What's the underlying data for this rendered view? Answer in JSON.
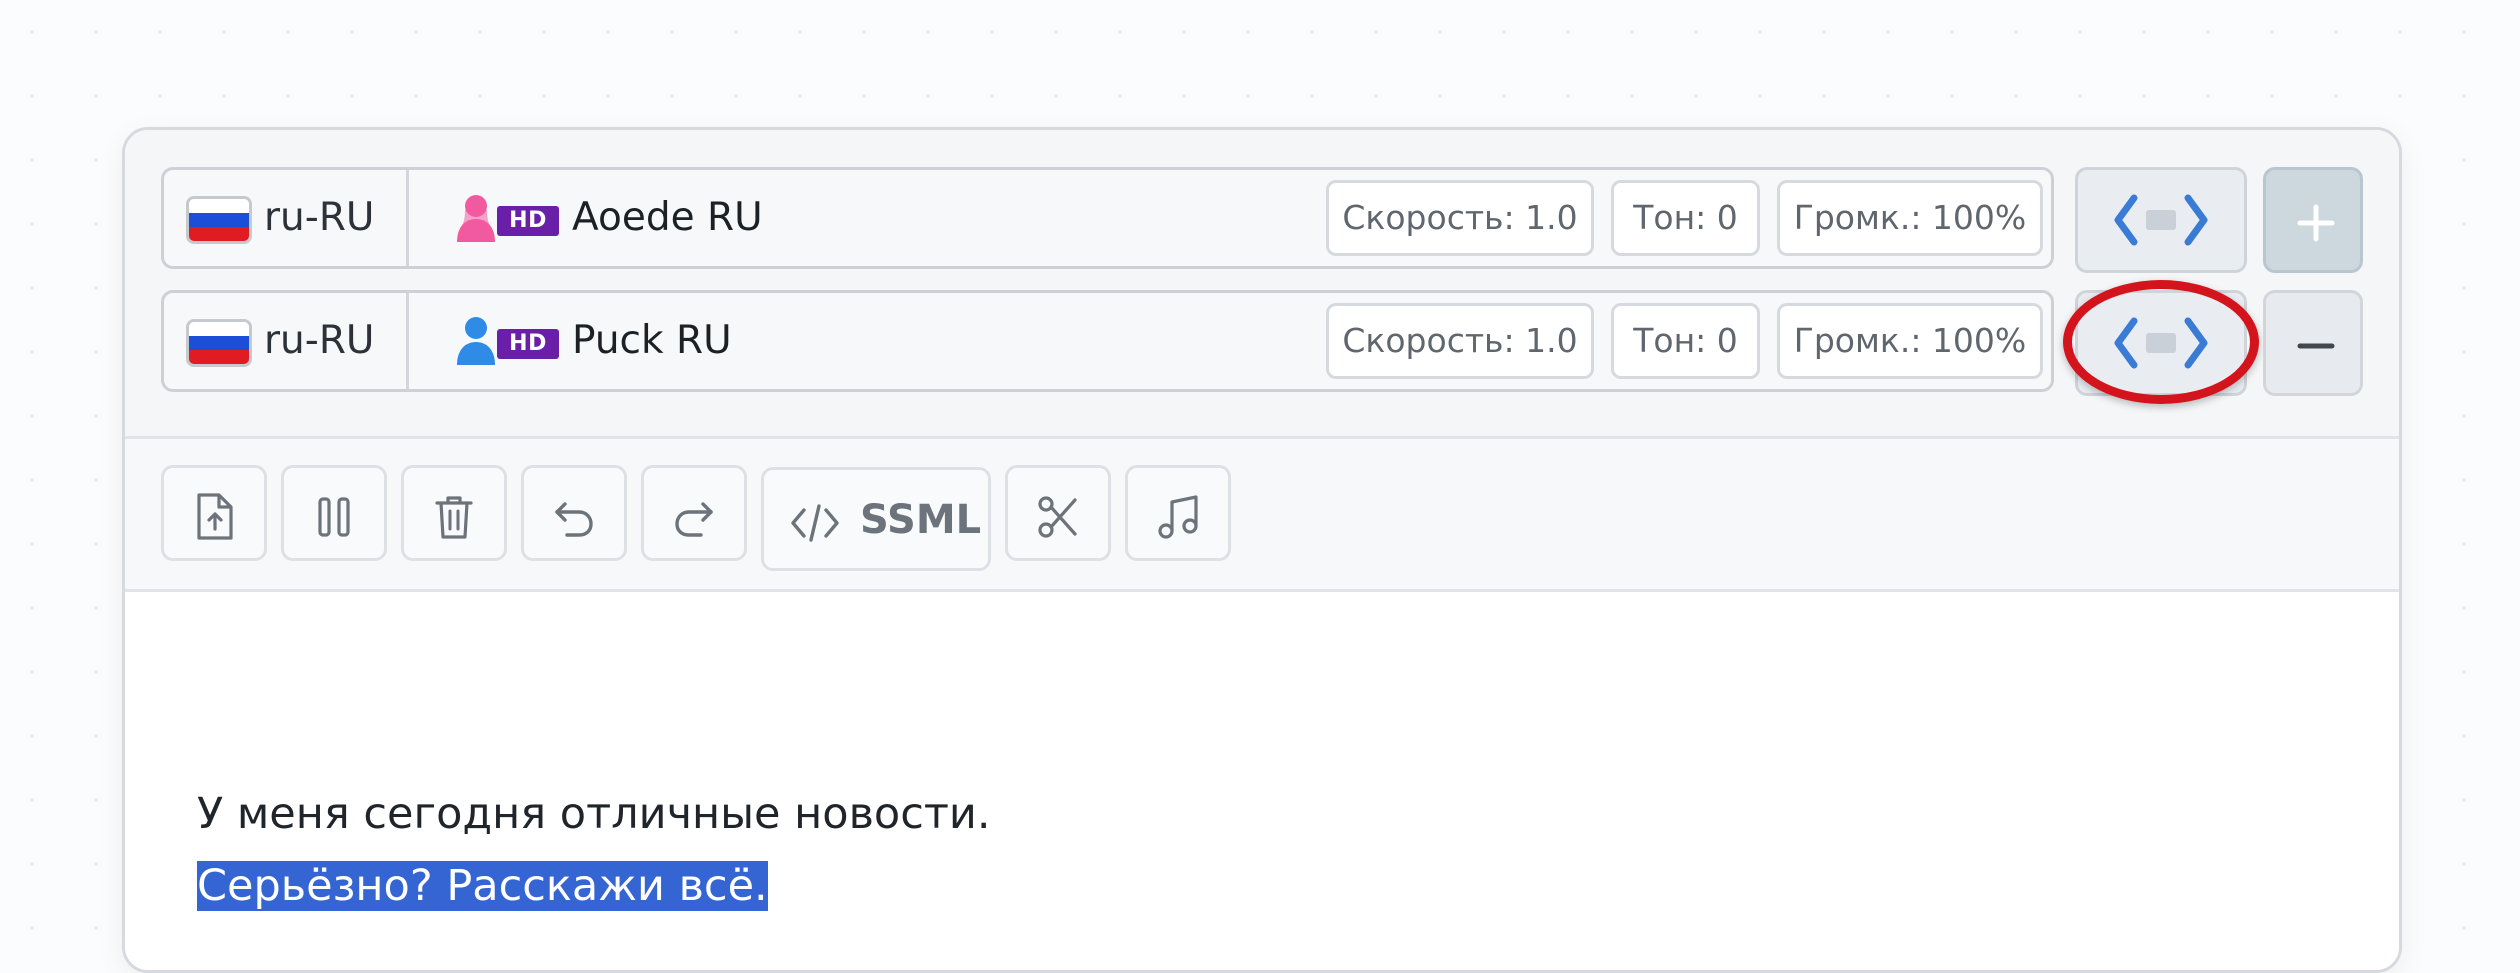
{
  "voices": [
    {
      "language": "ru-RU",
      "flag_icon": "russia-flag-icon",
      "gender_icon": "female-person-icon",
      "gender_color": "#f25aa0",
      "badge": "HD",
      "name": "Aoede RU",
      "speed_label": "Скорость: 1.0",
      "pitch_label": "Тон: 0",
      "volume_label": "Громк.: 100%"
    },
    {
      "language": "ru-RU",
      "flag_icon": "russia-flag-icon",
      "gender_icon": "male-person-icon",
      "gender_color": "#2f8ce6",
      "badge": "HD",
      "name": "Puck RU",
      "speed_label": "Скорость: 1.0",
      "pitch_label": "Тон: 0",
      "volume_label": "Громк.: 100%"
    }
  ],
  "row_actions": {
    "code_icon": "code-brackets-icon",
    "add_icon": "plus-icon",
    "remove_icon": "minus-icon",
    "highlighted": "second-row-code-button"
  },
  "toolbar": {
    "ssml_label": "SSML",
    "icons": [
      "upload-file-icon",
      "pause-icon",
      "trash-icon",
      "undo-icon",
      "redo-icon",
      "code-icon",
      "scissors-icon",
      "music-note-icon"
    ]
  },
  "editor": {
    "lines": [
      "У меня сегодня отличные новости.",
      "Серьёзно? Расскажи всё."
    ],
    "selected_line_index": 1
  },
  "colors": {
    "accent_blue": "#3a7bd5",
    "selection": "#3565d2",
    "highlight_ring": "#d4141c",
    "hd_badge": "#6a1fa8"
  }
}
